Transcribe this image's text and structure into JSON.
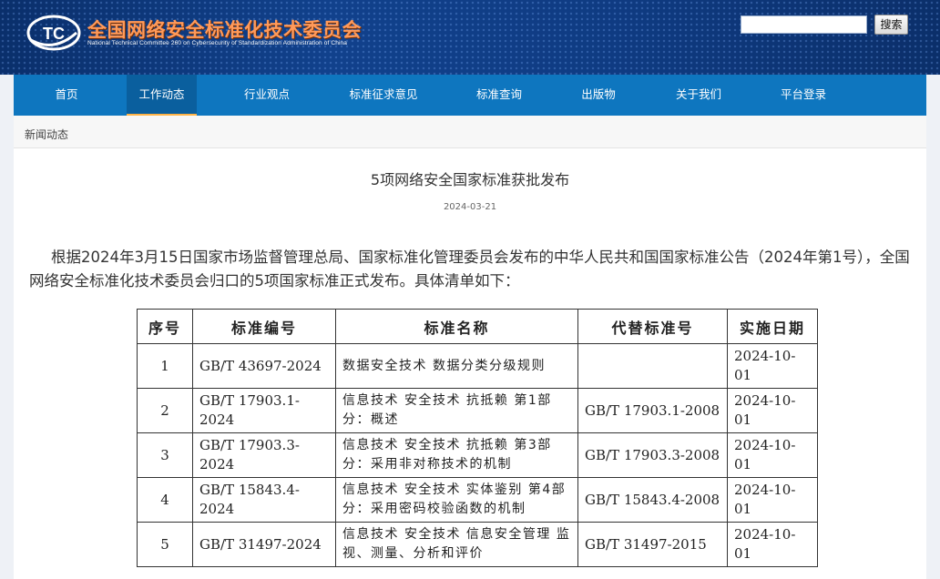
{
  "header": {
    "title": "全国网络安全标准化技术委员会",
    "subtitle": "National Technical Committee 260 on Cybersecurity of Standardization Administration of China",
    "logo_text": "TC",
    "search_placeholder": "",
    "search_button": "搜索"
  },
  "nav": {
    "items": [
      {
        "label": "首页"
      },
      {
        "label": "工作动态"
      },
      {
        "label": "行业观点"
      },
      {
        "label": "标准征求意见"
      },
      {
        "label": "标准查询"
      },
      {
        "label": "出版物"
      },
      {
        "label": "关于我们"
      },
      {
        "label": "平台登录"
      }
    ],
    "active": "工作动态"
  },
  "breadcrumb": "新闻动态",
  "article": {
    "title": "5项网络安全国家标准获批发布",
    "date": "2024-03-21",
    "body": "根据2024年3月15日国家市场监督管理总局、国家标准化管理委员会发布的中华人民共和国国家标准公告（2024年第1号），全国网络安全标准化技术委员会归口的5项国家标准正式发布。具体清单如下："
  },
  "table": {
    "headers": [
      "序号",
      "标准编号",
      "标准名称",
      "代替标准号",
      "实施日期"
    ],
    "rows": [
      [
        "1",
        "GB/T 43697-2024",
        "数据安全技术 数据分类分级规则",
        "",
        "2024-10-01"
      ],
      [
        "2",
        "GB/T 17903.1-2024",
        "信息技术 安全技术 抗抵赖 第1部分：概述",
        "GB/T 17903.1-2008",
        "2024-10-01"
      ],
      [
        "3",
        "GB/T 17903.3-2024",
        "信息技术 安全技术 抗抵赖 第3部分：采用非对称技术的机制",
        "GB/T 17903.3-2008",
        "2024-10-01"
      ],
      [
        "4",
        "GB/T 15843.4-2024",
        "信息技术 安全技术 实体鉴别 第4部分：采用密码校验函数的机制",
        "GB/T 15843.4-2008",
        "2024-10-01"
      ],
      [
        "5",
        "GB/T 31497-2024",
        "信息技术 安全技术 信息安全管理 监视、测量、分析和评价",
        "GB/T 31497-2015",
        "2024-10-01"
      ]
    ]
  },
  "colors": {
    "header_bg": "#11418c",
    "nav_bg": "#0e76bf",
    "title_orange": "#ff9a5a",
    "active_underline": "#ffb347"
  }
}
